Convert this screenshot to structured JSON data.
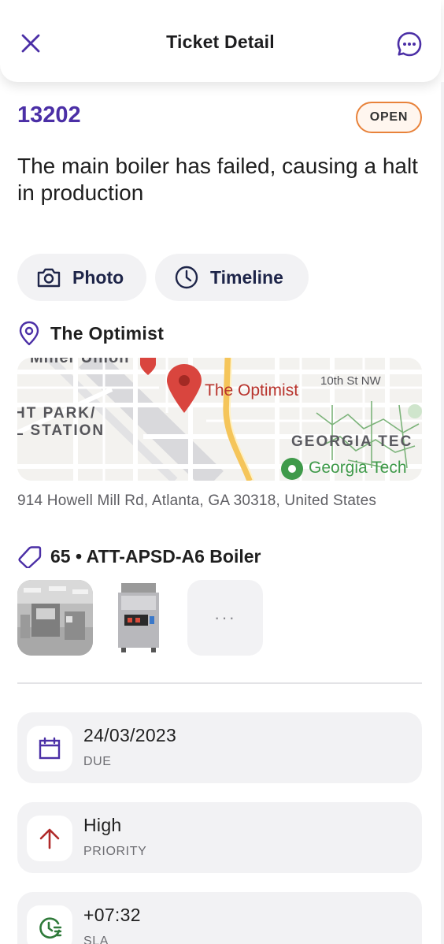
{
  "header": {
    "title": "Ticket Detail",
    "close_icon": "close-icon",
    "chat_icon": "chat-bubble-icon"
  },
  "ticket": {
    "id": "13202",
    "status": "OPEN",
    "status_color": "#e8823a",
    "title": "The main boiler has failed, causing a halt in production"
  },
  "actions": {
    "photo_label": "Photo",
    "timeline_label": "Timeline"
  },
  "location": {
    "name": "The Optimist",
    "address": "914 Howell Mill Rd, Atlanta, GA 30318, United States",
    "map": {
      "pin_label": "The Optimist",
      "street_label": "10th St NW",
      "district_label_line1": "HT PARK/",
      "district_label_line2": "L STATION",
      "poi_top": "Miller Union",
      "campus_label": "GEORGIA TEC",
      "campus_poi": "Georgia Tech"
    }
  },
  "asset": {
    "label": "65 • ATT-APSD-A6 Boiler",
    "more_label": "···"
  },
  "details": [
    {
      "value": "24/03/2023",
      "label": "DUE",
      "icon": "calendar-icon",
      "color": "#4b2fa6"
    },
    {
      "value": "High",
      "label": "PRIORITY",
      "icon": "arrow-up-icon",
      "color": "#b02a2a"
    },
    {
      "value": "+07:32",
      "label": "SLA",
      "icon": "clock-sla-icon",
      "color": "#2f7a3a"
    }
  ],
  "colors": {
    "accent": "#4b2fa6",
    "chip_bg": "#f2f2f4"
  }
}
